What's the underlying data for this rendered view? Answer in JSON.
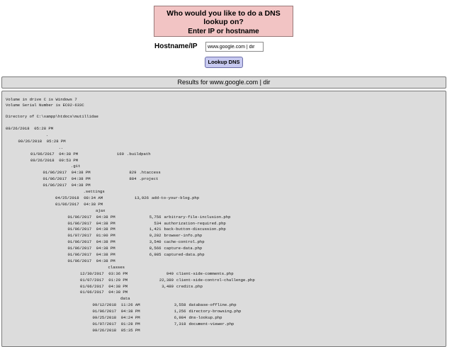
{
  "prompt": {
    "title": "Who would you like to do a DNS lookup on?",
    "subtitle": "Enter IP or hostname"
  },
  "form": {
    "hostname_label": "Hostname/IP",
    "hostname_value": "www.google.com | dir",
    "lookup_button": "Lookup DNS"
  },
  "results": {
    "header": "Results for www.google.com | dir",
    "volume_line": "Volume in drive C is Windows 7",
    "serial_line": "Volume Serial Number is EC02-633C",
    "directory_line": "Directory of C:\\xampp\\htdocs\\mutillidae",
    "dir_entries": [
      {
        "date": "09/26/2018  05:28 PM",
        "name": ""
      },
      {
        "date": "",
        "name": "."
      },
      {
        "date": "09/26/2018  05:28 PM",
        "name": ""
      },
      {
        "date": "",
        "name": ".."
      },
      {
        "date": "01/06/2017  04:38 PM",
        "size": "169",
        "name": ".buildpath"
      },
      {
        "date": "09/26/2018  09:53 PM",
        "name": ""
      },
      {
        "date": "",
        "name": ".git"
      },
      {
        "date": "01/06/2017  04:38 PM",
        "size": "829",
        "name": ".htaccess"
      },
      {
        "date": "01/06/2017  04:38 PM",
        "size": "884",
        "name": ".project"
      },
      {
        "date": "01/06/2017  04:38 PM",
        "name": ""
      },
      {
        "date": "",
        "name": ".settings"
      },
      {
        "date": "04/25/2018  08:34 AM",
        "size": "13,926",
        "name": "add-to-your-blog.php"
      },
      {
        "date": "01/06/2017  04:38 PM",
        "name": ""
      },
      {
        "date": "",
        "name": "ajax"
      },
      {
        "date": "01/06/2017  04:38 PM",
        "size": "5,756",
        "name": "arbitrary-file-inclusion.php"
      },
      {
        "date": "01/06/2017  04:38 PM",
        "size": "534",
        "name": "authorization-required.php"
      },
      {
        "date": "01/06/2017  04:38 PM",
        "size": "1,421",
        "name": "back-button-discussion.php"
      },
      {
        "date": "01/07/2017  01:00 PM",
        "size": "9,202",
        "name": "browser-info.php"
      },
      {
        "date": "01/06/2017  04:38 PM",
        "size": "3,540",
        "name": "cache-control.php"
      },
      {
        "date": "01/06/2017  04:38 PM",
        "size": "8,566",
        "name": "capture-data.php"
      },
      {
        "date": "01/06/2017  04:38 PM",
        "size": "6,985",
        "name": "captured-data.php"
      },
      {
        "date": "01/06/2017  04:38 PM",
        "name": ""
      },
      {
        "date": "",
        "name": "classes"
      },
      {
        "date": "12/30/2017  03:36 PM",
        "size": "949",
        "name": "client-side-comments.php"
      },
      {
        "date": "01/07/2017  01:29 PM",
        "size": "22,389",
        "name": "client-side-control-challenge.php"
      },
      {
        "date": "01/06/2017  04:38 PM",
        "size": "3,489",
        "name": "credits.php"
      },
      {
        "date": "01/06/2017  04:38 PM",
        "name": ""
      },
      {
        "date": "",
        "name": "data"
      },
      {
        "date": "09/12/2018  11:26 AM",
        "size": "3,558",
        "name": "database-offline.php"
      },
      {
        "date": "01/06/2017  04:38 PM",
        "size": "1,256",
        "name": "directory-browsing.php"
      },
      {
        "date": "09/25/2018  04:24 PM",
        "size": "6,984",
        "name": "dns-lookup.php"
      },
      {
        "date": "01/07/2017  01:28 PM",
        "size": "7,318",
        "name": "document-viewer.php"
      },
      {
        "date": "09/26/2018  05:35 PM",
        "name": ""
      }
    ]
  }
}
